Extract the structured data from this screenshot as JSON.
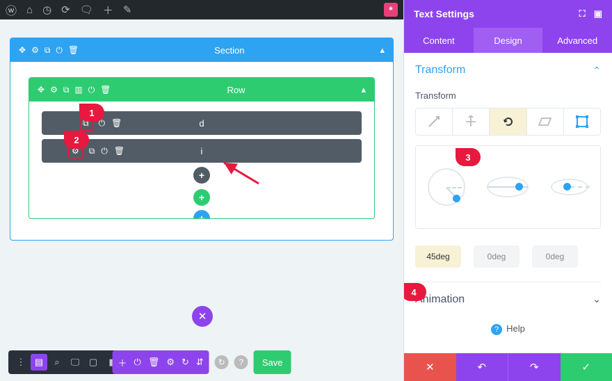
{
  "adminBar": {
    "ast": "*"
  },
  "section": {
    "title": "Section"
  },
  "row": {
    "title": "Row"
  },
  "modules": [
    {
      "label": "d",
      "highlight": "duplicate-icon"
    },
    {
      "label": "i",
      "highlight": "gear-icon"
    }
  ],
  "badges": {
    "b1": "1",
    "b2": "2",
    "b3": "3",
    "b4": "4"
  },
  "bottomBar": {
    "save": "Save"
  },
  "panel": {
    "title": "Text Settings",
    "tabs": {
      "content": "Content",
      "design": "Design",
      "advanced": "Advanced"
    },
    "transform": {
      "heading": "Transform",
      "label": "Transform"
    },
    "values": {
      "v1": "45deg",
      "v2": "0deg",
      "v3": "0deg"
    },
    "animation": "Animation",
    "help": "Help"
  }
}
